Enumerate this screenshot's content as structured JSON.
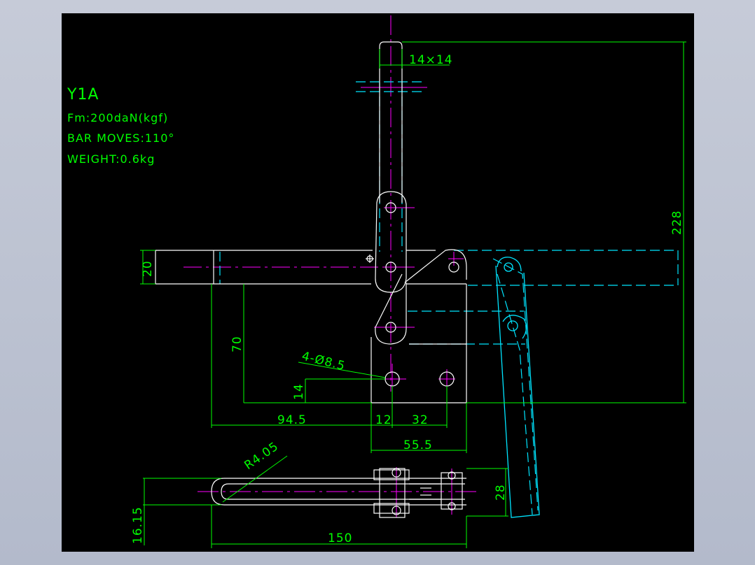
{
  "drawing": {
    "title": "Y1A",
    "specs": [
      "Fm:200daN(kgf)",
      "BAR MOVES:110°",
      "WEIGHT:0.6kg"
    ],
    "dimensions": {
      "bar_section": "14×14",
      "overall_height": "228",
      "bar_thickness": "20",
      "height_70": "70",
      "hole_height": "14",
      "holes": "4-Ø8.5",
      "len_94_5": "94.5",
      "len_12": "12",
      "len_32": "32",
      "base_width": "55.5",
      "radius": "R4.05",
      "height_28": "28",
      "offset": "16.15",
      "overall_length": "150"
    }
  },
  "colors": {
    "background": "#000000",
    "outline": "#ffffff",
    "dimension": "#00ff00",
    "centerline": "#ff00ff",
    "hidden": "#00ffff",
    "frame": "#b3bacb"
  }
}
